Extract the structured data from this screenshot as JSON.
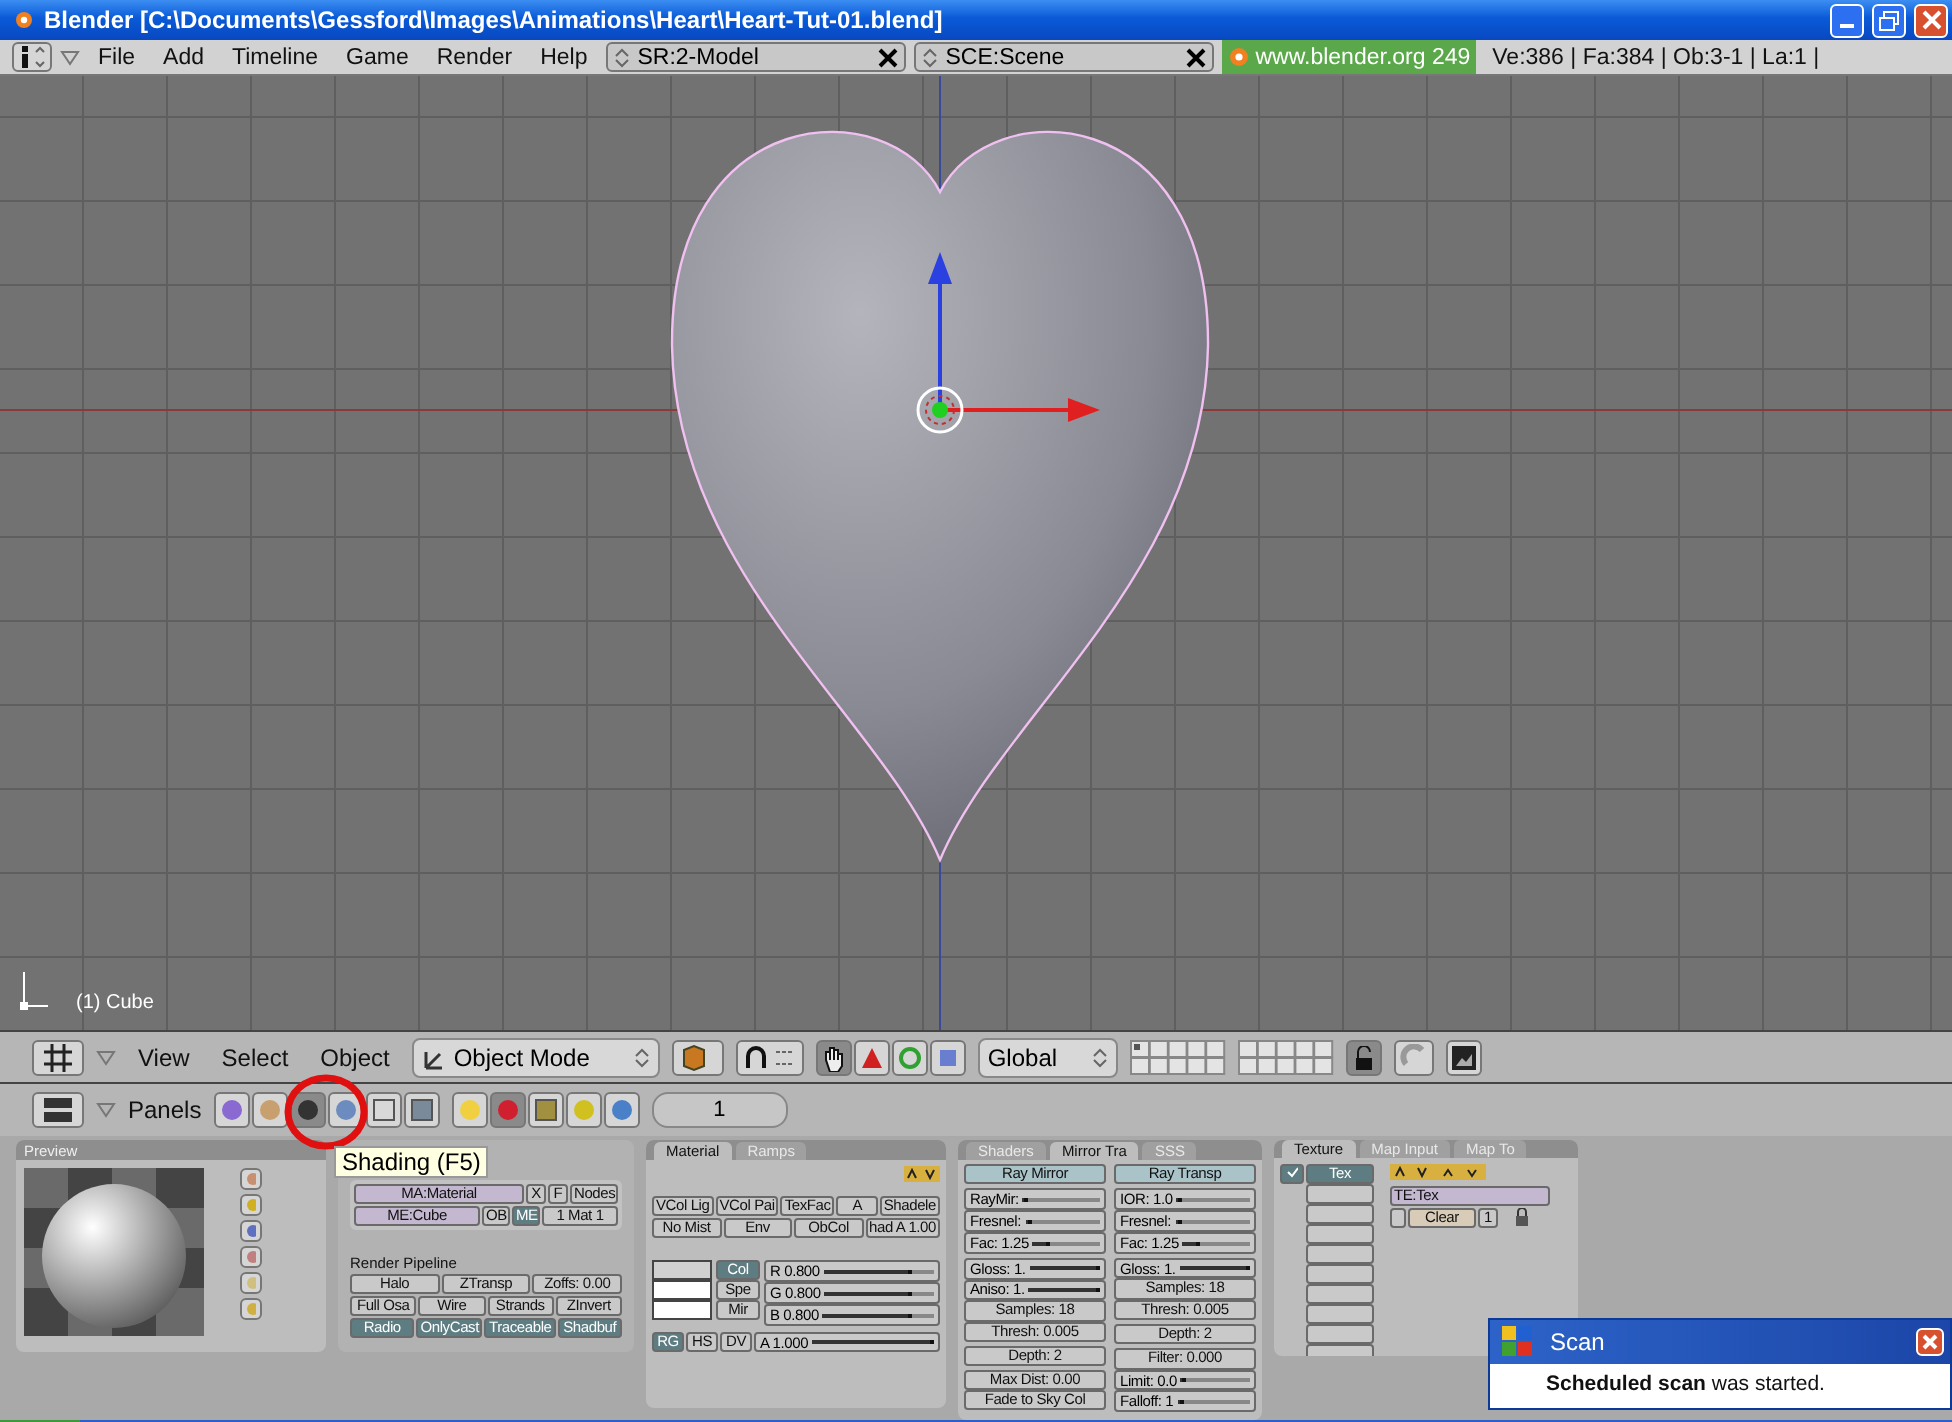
{
  "window": {
    "title": "Blender [C:\\Documents\\Gessford\\Images\\Animations\\Heart\\Heart-Tut-01.blend]"
  },
  "main_header": {
    "menus": [
      "File",
      "Add",
      "Timeline",
      "Game",
      "Render",
      "Help"
    ],
    "screen": "SR:2-Model",
    "scene": "SCE:Scene",
    "site": "www.blender.org 249",
    "stats": "Ve:386 | Fa:384 | Ob:3-1 | La:1 |"
  },
  "viewport": {
    "object_label": "(1) Cube"
  },
  "view_header": {
    "menus": [
      "View",
      "Select",
      "Object"
    ],
    "mode": "Object Mode",
    "orientation": "Global"
  },
  "buttons_header": {
    "label": "Panels",
    "frame": "1",
    "contexts": [
      {
        "kind": "logic",
        "selected": false
      },
      {
        "kind": "script",
        "selected": false
      },
      {
        "kind": "shading",
        "selected": true
      },
      {
        "kind": "object",
        "selected": false
      },
      {
        "kind": "editing",
        "selected": false
      },
      {
        "kind": "scene",
        "selected": false
      }
    ],
    "subcontexts": [
      {
        "kind": "lamp",
        "selected": false
      },
      {
        "kind": "material",
        "selected": true
      },
      {
        "kind": "texture",
        "selected": false
      },
      {
        "kind": "radio",
        "selected": false
      },
      {
        "kind": "world",
        "selected": false
      }
    ]
  },
  "tooltip": "Shading (F5)",
  "preview": {
    "title": "Preview"
  },
  "links": {
    "material": "MA:Material",
    "x": "X",
    "f": "F",
    "nodes": "Nodes",
    "mesh": "ME:Cube",
    "link_to": [
      {
        "label": "OB",
        "selected": false
      },
      {
        "label": "ME",
        "selected": true
      }
    ],
    "index": "1 Mat 1"
  },
  "pipeline": {
    "title": "Render Pipeline",
    "zoffs": "Zoffs: 0.00",
    "rows": [
      [
        {
          "label": "Halo",
          "on": false
        },
        {
          "label": "ZTransp",
          "on": false
        }
      ],
      [
        {
          "label": "Full Osa",
          "on": false
        },
        {
          "label": "Wire",
          "on": false
        },
        {
          "label": "Strands",
          "on": false
        },
        {
          "label": "ZInvert",
          "on": false
        }
      ],
      [
        {
          "label": "Radio",
          "on": true
        },
        {
          "label": "OnlyCast",
          "on": true
        },
        {
          "label": "Traceable",
          "on": true
        },
        {
          "label": "Shadbuf",
          "on": true
        }
      ]
    ]
  },
  "material": {
    "tabs": [
      {
        "label": "Material",
        "selected": true
      },
      {
        "label": "Ramps",
        "selected": false
      }
    ],
    "toggles": [
      [
        {
          "label": "VCol Lig",
          "on": false
        },
        {
          "label": "VCol Pai",
          "on": false
        },
        {
          "label": "TexFac",
          "on": false
        },
        {
          "label": "A",
          "on": false
        },
        {
          "label": "Shadele",
          "on": false
        }
      ],
      [
        {
          "label": "No Mist",
          "on": false
        },
        {
          "label": "Env",
          "on": false
        },
        {
          "label": "ObCol",
          "on": false
        }
      ]
    ],
    "shadow_alpha": "had A 1.00",
    "colors": [
      {
        "label": "Col",
        "selected": true,
        "color": "#d0d0d0"
      },
      {
        "label": "Spe",
        "selected": false,
        "color": "#ffffff"
      },
      {
        "label": "Mir",
        "selected": false,
        "color": "#ffffff"
      }
    ],
    "sliders": [
      {
        "label": "R 0.800",
        "level": 0.8
      },
      {
        "label": "G 0.800",
        "level": 0.8
      },
      {
        "label": "B 0.800",
        "level": 0.8
      }
    ],
    "models": [
      {
        "label": "RG",
        "selected": true
      },
      {
        "label": "HS",
        "selected": false
      },
      {
        "label": "DV",
        "selected": false
      }
    ],
    "alpha": {
      "label": "A 1.000",
      "level": 1
    }
  },
  "shaders": {
    "tabs": [
      {
        "label": "Shaders",
        "selected": false
      },
      {
        "label": "Mirror Tra",
        "selected": true
      },
      {
        "label": "SSS",
        "selected": false
      }
    ],
    "columns": [
      [
        [
          {
            "kind": "button",
            "label": "Ray Mirror"
          }
        ],
        [
          {
            "kind": "slider",
            "label": "RayMir:",
            "level": 0
          },
          {
            "kind": "slider",
            "label": "Fresnel:",
            "level": 0
          },
          {
            "kind": "slider",
            "label": "Fac: 1.25",
            "level": 0.25
          }
        ],
        [
          {
            "kind": "slider",
            "label": "Gloss: 1.",
            "level": 1
          },
          {
            "kind": "slider",
            "label": "Aniso: 1.",
            "level": 1
          },
          {
            "kind": "number",
            "label": "Samples: 18"
          },
          {
            "kind": "number",
            "label": "Thresh: 0.005"
          }
        ],
        [
          {
            "kind": "number",
            "label": "Depth: 2"
          }
        ],
        [
          {
            "kind": "number",
            "label": "Max Dist: 0.00"
          },
          {
            "kind": "menu",
            "label": "Fade to Sky Col"
          }
        ]
      ],
      [
        [
          {
            "kind": "button",
            "label": "Ray Transp"
          }
        ],
        [
          {
            "kind": "slider",
            "label": "IOR: 1.0",
            "level": 0
          },
          {
            "kind": "slider",
            "label": "Fresnel:",
            "level": 0
          },
          {
            "kind": "slider",
            "label": "Fac: 1.25",
            "level": 0.25
          }
        ],
        [
          {
            "kind": "slider",
            "label": "Gloss: 1.",
            "level": 1
          },
          {
            "kind": "number",
            "label": "Samples: 18"
          },
          {
            "kind": "number",
            "label": "Thresh: 0.005"
          }
        ],
        [
          {
            "kind": "number",
            "label": "Depth: 2"
          }
        ],
        [
          {
            "kind": "number",
            "label": "Filter: 0.000"
          },
          {
            "kind": "slider",
            "label": "Limit: 0.0",
            "level": 0
          },
          {
            "kind": "slider",
            "label": "Falloff: 1",
            "level": 0.1
          }
        ]
      ]
    ]
  },
  "texture": {
    "tabs": [
      {
        "label": "Texture",
        "selected": true
      },
      {
        "label": "Map Input",
        "selected": false
      },
      {
        "label": "Map To",
        "selected": false
      }
    ],
    "slots": [
      {
        "label": "Tex",
        "selected": true
      }
    ],
    "name": "TE:Tex",
    "clear": "Clear",
    "users": "1"
  },
  "notification": {
    "title": "Scan",
    "message": "**Scheduled scan** was started."
  }
}
